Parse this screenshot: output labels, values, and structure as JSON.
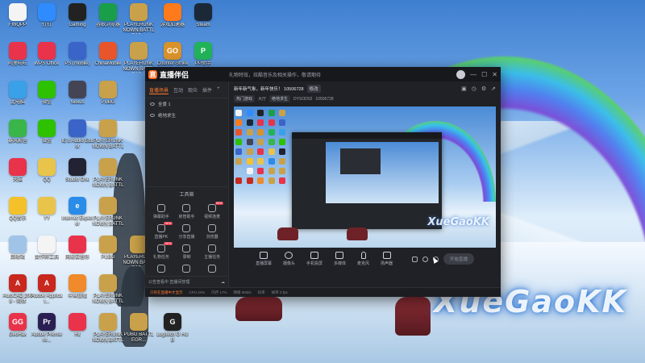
{
  "desktop": {
    "icons": [
      {
        "label": "FWQPP",
        "color": "#f4f4f4",
        "glyph": ""
      },
      {
        "label": "钉钉",
        "color": "#2f8cff",
        "glyph": ""
      },
      {
        "label": "Gaming",
        "color": "#222",
        "glyph": ""
      },
      {
        "label": "谷歌浏览器",
        "color": "#1a9e4a",
        "glyph": ""
      },
      {
        "label": "PLAYERUNKNOWN BATTLEGR...",
        "color": "#c9a14a",
        "glyph": ""
      },
      {
        "label": "游戏加速器",
        "color": "#ff7a1a",
        "glyph": ""
      },
      {
        "label": "Steam",
        "color": "#1b2838",
        "glyph": ""
      },
      {
        "label": "阿里旺旺",
        "color": "#e8334a",
        "glyph": ""
      },
      {
        "label": "WPS Office",
        "color": "#e8334a",
        "glyph": ""
      },
      {
        "label": "PS (mobile)",
        "color": "#3a64c8",
        "glyph": ""
      },
      {
        "label": "ChinaMobile",
        "color": "#e8552a",
        "glyph": ""
      },
      {
        "label": "PLAYERUNKNOWN BATTLEGR...",
        "color": "#c9a14a",
        "glyph": ""
      },
      {
        "label": "Counter-Strike",
        "color": "#d8922a",
        "glyph": "GO"
      },
      {
        "label": "PP助手",
        "color": "#22b35a",
        "glyph": "P"
      },
      {
        "label": "此电脑",
        "color": "#3aa0e8",
        "glyph": ""
      },
      {
        "label": "微信",
        "color": "#2dc100",
        "glyph": ""
      },
      {
        "label": "Nexus",
        "color": "#445",
        "glyph": ""
      },
      {
        "label": "PUBG",
        "color": "#c9a14a",
        "glyph": ""
      },
      {
        "label": "暴风影音",
        "color": "#39b54a",
        "glyph": ""
      },
      {
        "label": "微信",
        "color": "#2dc100",
        "glyph": ""
      },
      {
        "label": "IE 8 Audio Editor",
        "color": "#3a64c8",
        "glyph": ""
      },
      {
        "label": "PLAYERUNKNOWN BATTLEGR...",
        "color": "#c9a14a",
        "glyph": ""
      },
      {
        "label": "天猫",
        "color": "#e8334a",
        "glyph": ""
      },
      {
        "label": "QQ",
        "color": "#e8c44a",
        "glyph": ""
      },
      {
        "label": "Studio One",
        "color": "#223",
        "glyph": ""
      },
      {
        "label": "PLAYERUNKNOWN BATTLEGR...",
        "color": "#c9a14a",
        "glyph": ""
      },
      {
        "label": "QQ音乐",
        "color": "#f4c12a",
        "glyph": ""
      },
      {
        "label": "YY",
        "color": "#e8c44a",
        "glyph": ""
      },
      {
        "label": "Internet Explorer",
        "color": "#2a8ce8",
        "glyph": "e"
      },
      {
        "label": "PLAYERUNKNOWN BATTLEGR...",
        "color": "#c9a14a",
        "glyph": ""
      },
      {
        "label": "回收站",
        "color": "#9fc4e8",
        "glyph": ""
      },
      {
        "label": "反作弊工具",
        "color": "#f4f4f4",
        "glyph": ""
      },
      {
        "label": "网易云音乐",
        "color": "#e8334a",
        "glyph": ""
      },
      {
        "label": "PUBG",
        "color": "#c9a14a",
        "glyph": ""
      },
      {
        "label": "PLAYERUNKNOWN BATTLEGR...",
        "color": "#c9a14a",
        "glyph": ""
      },
      {
        "label": "AutoCAD 2008 - 简体",
        "color": "#c8281e",
        "glyph": "A"
      },
      {
        "label": "Adobe Applicat...",
        "color": "#c8281e",
        "glyph": "A"
      },
      {
        "label": "斗鱼直播",
        "color": "#f08a2a",
        "glyph": ""
      },
      {
        "label": "PLAYERUNKNOWN BATTLEGR...",
        "color": "#c9a14a",
        "glyph": ""
      },
      {
        "label": "GeoHax",
        "color": "#e8334a",
        "glyph": "GG"
      },
      {
        "label": "Adobe Premiere...",
        "color": "#2a1f52",
        "glyph": "Pr"
      },
      {
        "label": "Hit",
        "color": "#e8334a",
        "glyph": ""
      },
      {
        "label": "PLAYERUNKNOWN BATTLEGR...",
        "color": "#c9a14a",
        "glyph": ""
      },
      {
        "label": "PUBG BATTLEGR...",
        "color": "#c9a14a",
        "glyph": ""
      },
      {
        "label": "Logitech G HUB",
        "color": "#222",
        "glyph": "G"
      }
    ]
  },
  "app": {
    "title": "直播伴侣",
    "notice": "礼物特效，炫酷音乐及相关操作，敬请期待",
    "controls": [
      "—",
      "☐",
      "✕"
    ],
    "tabs": [
      "直播场景",
      "互动",
      "观众",
      "插件"
    ],
    "scenes": [
      {
        "label": "全景 1"
      },
      {
        "label": "绝地求生"
      }
    ],
    "toolbox_title": "工具箱",
    "tools": [
      {
        "label": "弹幕助手",
        "badge": ""
      },
      {
        "label": "房管助手",
        "badge": ""
      },
      {
        "label": "视频连麦",
        "badge": "NEW"
      },
      {
        "label": "直播PK",
        "badge": "NEW"
      },
      {
        "label": "分享直播",
        "badge": ""
      },
      {
        "label": "浏览器",
        "badge": ""
      },
      {
        "label": "礼物任务",
        "badge": "NEW"
      },
      {
        "label": "录制",
        "badge": ""
      },
      {
        "label": "主播任务",
        "badge": ""
      },
      {
        "label": "",
        "badge": ""
      },
      {
        "label": "",
        "badge": ""
      },
      {
        "label": "",
        "badge": ""
      }
    ],
    "left_footer": "公告查看中 直播间管理",
    "room": {
      "title": "新年新气象，新年快乐！ 10506728",
      "edit_label": "修改",
      "subtitle_prefix": "热门游戏",
      "category": "大厅",
      "tag": "绝地求生",
      "room_id_label": "DYSOD02",
      "room_id": "10506728"
    },
    "preview": {
      "watermark": "XueGaoKK"
    },
    "bottom_controls": [
      {
        "label": "直播屏幕"
      },
      {
        "label": "摄像头"
      },
      {
        "label": "手机投屏"
      },
      {
        "label": "多媒体"
      },
      {
        "label": "麦克风"
      },
      {
        "label": "扬声器"
      }
    ],
    "start_button": "开始直播",
    "status": {
      "link": "只有在直播中才显示",
      "items": [
        "CPU 44%",
        "内存 17%",
        "网络 0KB/s",
        "码率",
        "帧率 0 fps"
      ]
    }
  },
  "wallpaper": {
    "watermark": "XueGaoKK"
  }
}
